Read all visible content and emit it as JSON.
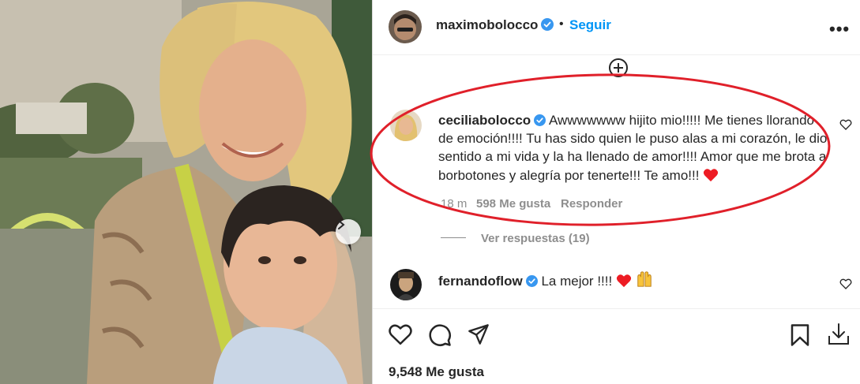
{
  "post": {
    "author": "maximobolocco",
    "separator": "•",
    "follow_label": "Seguir",
    "more_label": "•••"
  },
  "comments": [
    {
      "username": "ceciliabolocco",
      "text": "Awwwwwww hijito mio!!!!! Me tienes llorando de emoción!!!! Tu has sido quien le puso alas a mi corazón, le dio sentido a mi vida y la ha llenado de amor!!!! Amor que me brota a borbotones y alegría por tenerte!!! Te amo!!!",
      "time": "18 m",
      "likes": "598 Me gusta",
      "reply_label": "Responder",
      "view_replies": "Ver respuestas (19)"
    },
    {
      "username": "fernandoflow",
      "text": "La mejor !!!!"
    }
  ],
  "footer": {
    "likes_count": "9,548 Me gusta"
  },
  "colors": {
    "accent": "#0095f6",
    "verified": "#3897f0",
    "annotation": "#e0202a",
    "heart": "#ed1c24"
  },
  "icons": {
    "like": "heart-outline-icon",
    "comment": "speech-bubble-icon",
    "share": "paper-plane-icon",
    "save": "bookmark-icon",
    "download": "download-icon",
    "next": "chevron-right-icon"
  }
}
